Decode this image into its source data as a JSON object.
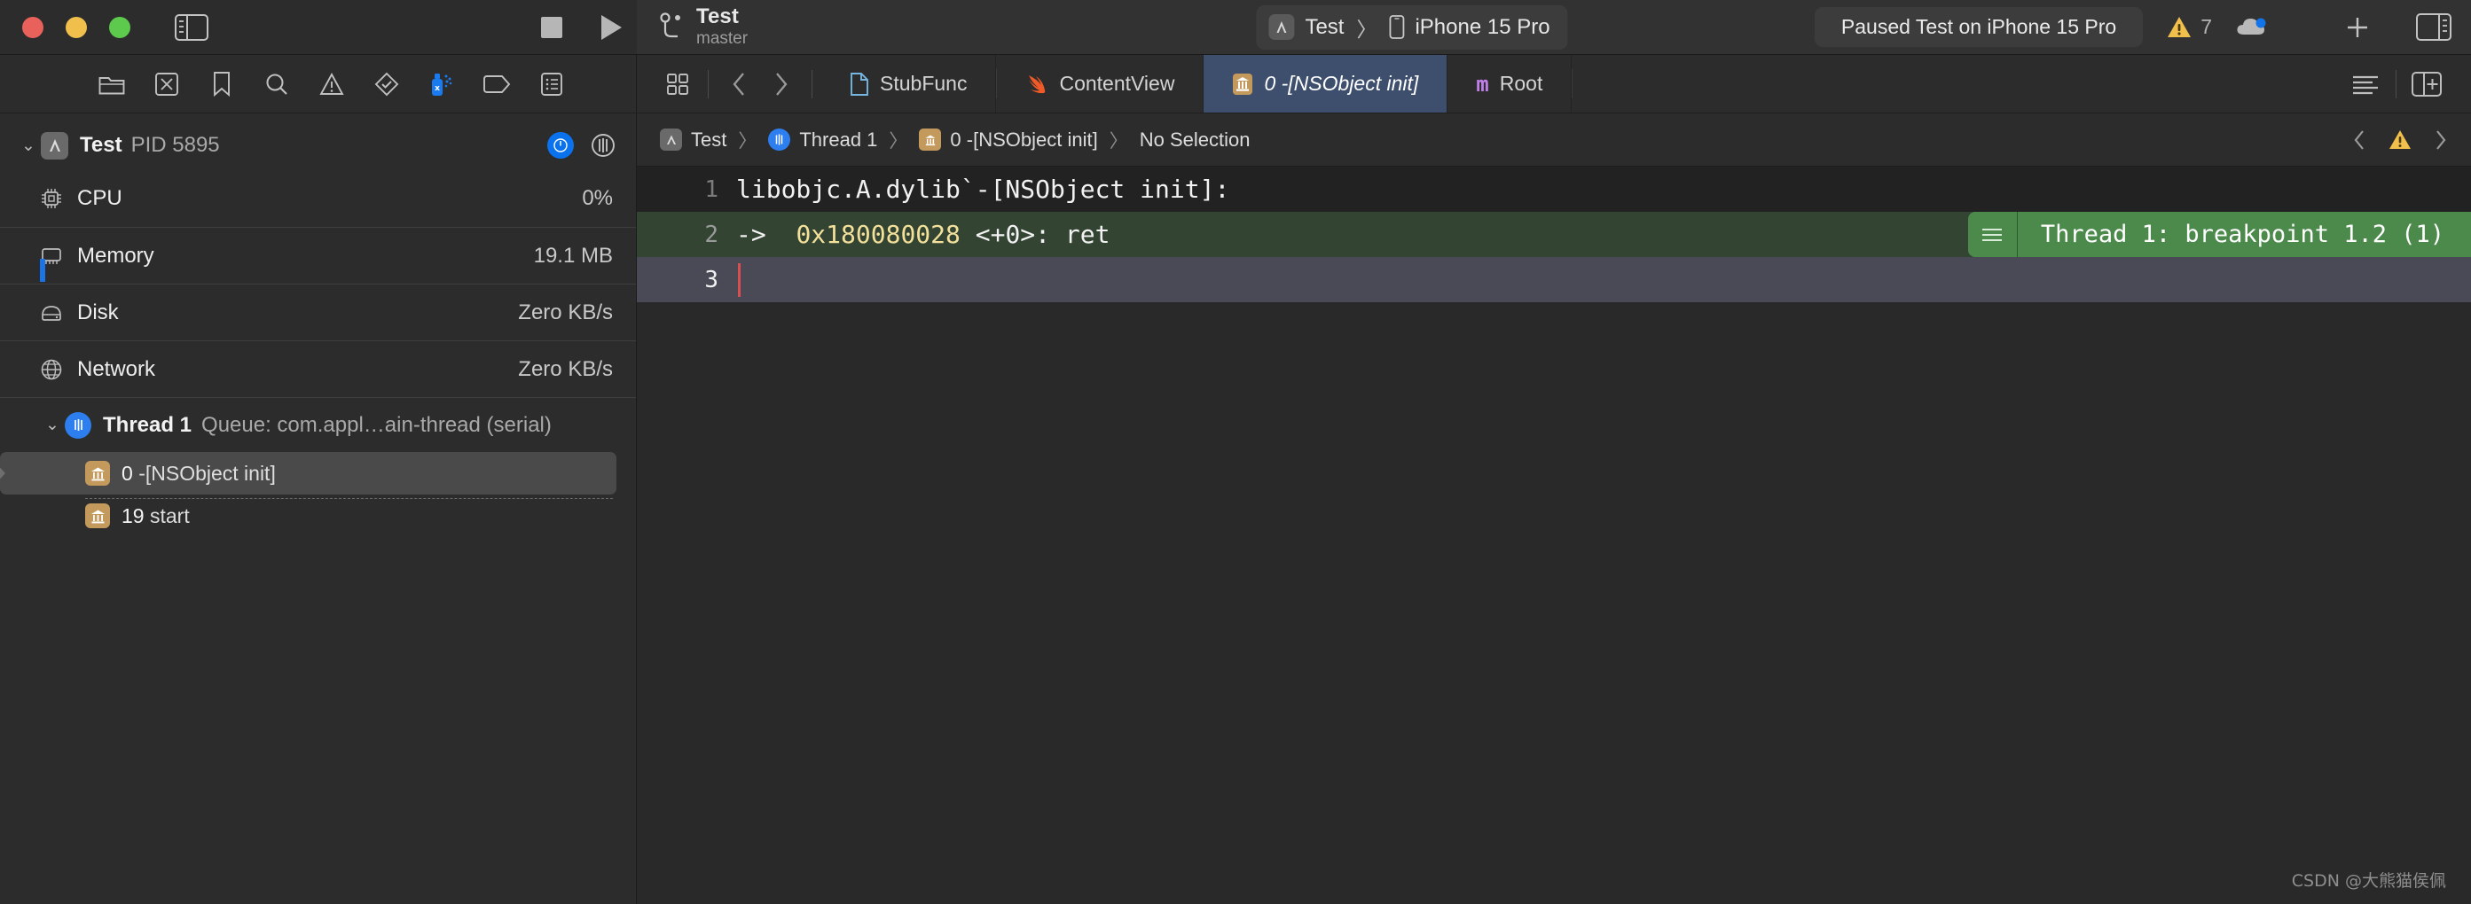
{
  "window": {
    "traffic_lights": [
      "close",
      "minimize",
      "zoom"
    ],
    "sidebar_toggle": "toggle-navigator"
  },
  "toolbar": {
    "scheme_name": "Test",
    "scheme_branch": "master",
    "run_destination": {
      "scheme": "Test",
      "separator": "〉",
      "device": "iPhone 15 Pro"
    },
    "status_text": "Paused Test on iPhone 15 Pro",
    "warning_count": "7",
    "stop_button": "stop",
    "run_button": "run",
    "add_button": "+",
    "inspector_toggle": "toggle-inspector",
    "cloud_icon": "cloud-sync"
  },
  "navigator": {
    "toolbar_icons": [
      "folder-icon",
      "source-control-icon",
      "bookmark-icon",
      "search-icon",
      "issue-warning-icon",
      "test-diamond-icon",
      "debug-spray-icon",
      "breakpoint-tag-icon",
      "report-list-icon"
    ],
    "active_toolbar_icon": "debug-spray-icon",
    "process": {
      "name": "Test",
      "pid": "PID 5895",
      "info_badge": "info",
      "thread_badge": "threads"
    },
    "gauges": [
      {
        "icon": "cpu-icon",
        "label": "CPU",
        "value": "0%"
      },
      {
        "icon": "memory-icon",
        "label": "Memory",
        "value": "19.1 MB"
      },
      {
        "icon": "disk-icon",
        "label": "Disk",
        "value": "Zero KB/s"
      },
      {
        "icon": "network-icon",
        "label": "Network",
        "value": "Zero KB/s"
      }
    ],
    "thread": {
      "name": "Thread 1",
      "queue": "Queue: com.appl…ain-thread (serial)"
    },
    "frames": [
      {
        "index": "0",
        "symbol": "-[NSObject init]",
        "selected": true
      },
      {
        "index": "19",
        "symbol": "start",
        "selected": false
      }
    ]
  },
  "editor": {
    "tabs": [
      {
        "label": "StubFunc",
        "icon": "file-icon",
        "active": false
      },
      {
        "label": "ContentView",
        "icon": "swift-icon",
        "active": false
      },
      {
        "label": "0 -[NSObject init]",
        "icon": "frame-icon",
        "active": true
      },
      {
        "label": "Root",
        "icon": "objc-m-icon",
        "active": false
      }
    ],
    "nav_back": "‹",
    "nav_forward": "›",
    "grid_button": "editor-grid",
    "options_button": "editor-options",
    "add_editor_button": "add-editor",
    "breadcrumb": [
      {
        "label": "Test",
        "icon": "app-icon"
      },
      {
        "label": "Thread 1",
        "icon": "thread-icon"
      },
      {
        "label": "0 -[NSObject init]",
        "icon": "frame-icon"
      },
      {
        "label": "No Selection",
        "icon": "none"
      }
    ],
    "breadcrumb_sep": "〉",
    "issue_prev": "‹",
    "issue_next": "›",
    "issue_icon": "warning-triangle-icon"
  },
  "code": {
    "lines": [
      {
        "num": "1",
        "text": "libobjc.A.dylib`-[NSObject init]:",
        "style": "header"
      },
      {
        "num": "2",
        "prefix": "->  ",
        "address": "0x180080028",
        "suffix": " <+0>: ret",
        "style": "current-pc"
      },
      {
        "num": "3",
        "text": "",
        "style": "cursor-line"
      }
    ],
    "breakpoint_annotation": "Thread 1: breakpoint 1.2 (1)"
  },
  "watermark": "CSDN @大熊猫侯佩",
  "colors": {
    "accent_blue": "#0a72ec",
    "active_tab": "#3e4f6e",
    "breakpoint_green": "#4c8a4c",
    "current_line": "#4a4a57",
    "address_yellow": "#f3e09a",
    "warning_yellow": "#f0bf4c",
    "frame_tan": "#c49a5c"
  }
}
